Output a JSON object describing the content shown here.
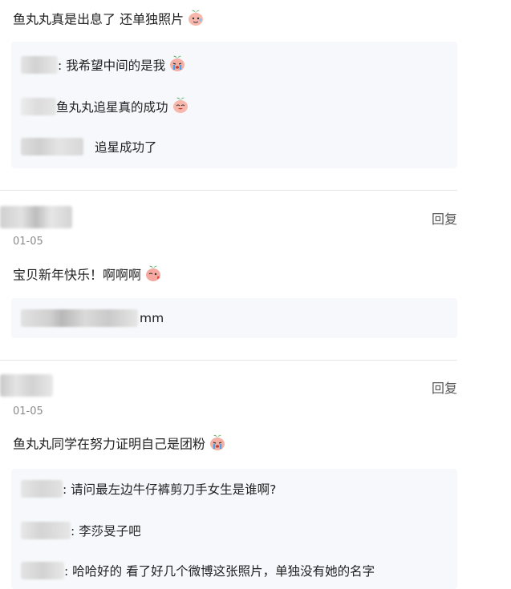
{
  "thread1": {
    "comment": "鱼丸丸真是出息了 还单独照片",
    "replies": [
      {
        "text": ": 我希望中间的是我"
      },
      {
        "text": "鱼丸丸追星真的成功"
      },
      {
        "text": "追星成功了"
      }
    ]
  },
  "thread2": {
    "date": "01-05",
    "reply_label": "回复",
    "comment": "宝贝新年快乐！啊啊啊",
    "replies": [
      {
        "text": "mm"
      }
    ]
  },
  "thread3": {
    "date": "01-05",
    "reply_label": "回复",
    "comment": "鱼丸丸同学在努力证明自己是团粉",
    "replies": [
      {
        "text": ": 请问最左边牛仔裤剪刀手女生是谁啊?"
      },
      {
        "text": ": 李莎旻子吧"
      },
      {
        "text": ": 哈哈好的 看了好几个微博这张照片，单独没有她的名字"
      }
    ]
  },
  "icons": [
    "peach-tear-face-icon",
    "peach-crying-face-icon",
    "peach-laugh-face-icon",
    "peach-kiss-face-icon"
  ],
  "colors": {
    "reply_bg": "#f6f8fb",
    "divider": "#e6e6e6",
    "muted": "#8a8a8a"
  }
}
